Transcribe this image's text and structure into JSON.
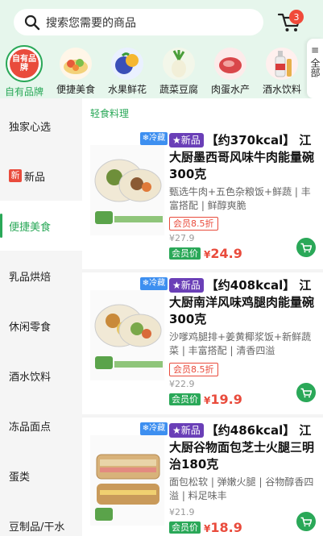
{
  "search": {
    "placeholder": "搜索您需要的商品"
  },
  "cart": {
    "badge": "3"
  },
  "categories": [
    {
      "label": "自有品牌",
      "logo_text": "自有品牌"
    },
    {
      "label": "便捷美食"
    },
    {
      "label": "水果鲜花"
    },
    {
      "label": "蔬菜豆腐"
    },
    {
      "label": "肉蛋水产"
    },
    {
      "label": "酒水饮料"
    }
  ],
  "all_button": {
    "icon": "≡",
    "label": "全部"
  },
  "sidebar": {
    "items": [
      {
        "label": "独家心选"
      },
      {
        "label": "新品",
        "tag": "新"
      },
      {
        "label": "便捷美食"
      },
      {
        "label": "乳品烘焙"
      },
      {
        "label": "休闲零食"
      },
      {
        "label": "酒水饮料"
      },
      {
        "label": "冻品面点"
      },
      {
        "label": "蛋类"
      },
      {
        "label": "豆制品/干水"
      }
    ]
  },
  "section": {
    "title": "轻食料理"
  },
  "products": [
    {
      "chill": "❄冷藏",
      "new_badge": "★新品",
      "title": "【约370kcal】 江大厨墨西哥风味牛肉能量碗300克",
      "desc": "甄选牛肉+五色杂粮饭+鲜蔬 | 丰富搭配 | 鲜醇爽脆",
      "discount": "会员8.5折",
      "orig_price": "¥27.9",
      "member_label": "会员价",
      "price_symbol": "¥",
      "price": "24.9"
    },
    {
      "chill": "❄冷藏",
      "new_badge": "★新品",
      "title": "【约408kcal】 江大厨南洋风味鸡腿肉能量碗300克",
      "desc": "沙嗲鸡腿排+姜黄椰浆饭+新鲜蔬菜 | 丰富搭配 | 清香四溢",
      "discount": "会员8.5折",
      "orig_price": "¥22.9",
      "member_label": "会员价",
      "price_symbol": "¥",
      "price": "19.9"
    },
    {
      "chill": "❄冷藏",
      "new_badge": "★新品",
      "title": "【约486kcal】 江大厨谷物面包芝士火腿三明治180克",
      "desc": "面包松软 | 弹嫩火腿 | 谷物醇香四溢 | 料足味丰",
      "orig_price": "¥21.9",
      "member_label": "会员价",
      "price_symbol": "¥",
      "price": "18.9"
    }
  ],
  "colors": {
    "brand_green": "#2aa858",
    "price_red": "#e94b3c",
    "header_bg": "#e6f6ec",
    "new_purple": "#6a3fb7",
    "chill_blue": "#3d8ff0"
  }
}
